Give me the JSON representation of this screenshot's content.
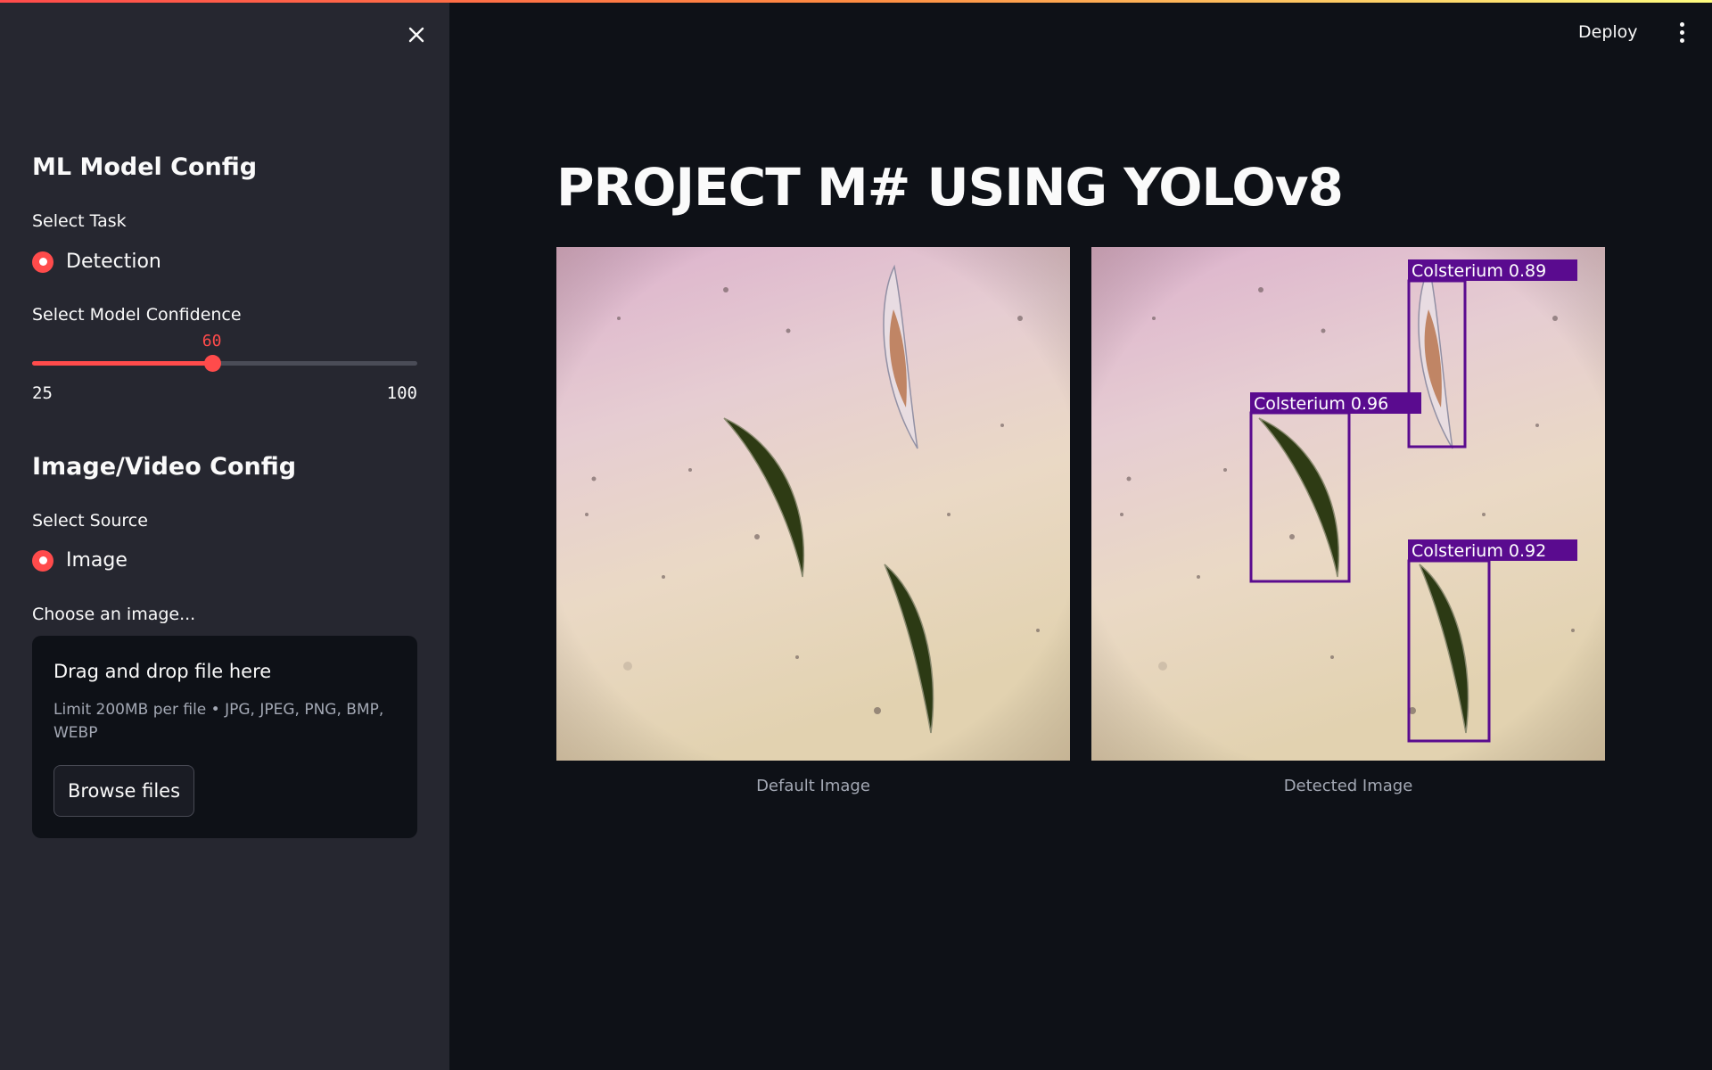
{
  "header": {
    "deploy_label": "Deploy",
    "menu_icon": "kebab-menu-icon"
  },
  "sidebar": {
    "close_icon": "close-icon",
    "model_config_heading": "ML Model Config",
    "task_label": "Select Task",
    "task_selected": "Detection",
    "confidence_label": "Select Model Confidence",
    "confidence": {
      "value": "60",
      "min": "25",
      "max": "100"
    },
    "source_heading": "Image/Video Config",
    "source_label": "Select Source",
    "source_selected": "Image",
    "choose_label": "Choose an image...",
    "uploader": {
      "title": "Drag and drop file here",
      "limit": "Limit 200MB per file • JPG, JPEG, PNG, BMP, WEBP",
      "button": "Browse files"
    }
  },
  "main": {
    "title": "PROJECT M# USING YOLOv8",
    "images": [
      {
        "caption": "Default Image"
      },
      {
        "caption": "Detected Image",
        "detections": [
          {
            "label": "Colsterium 0.89"
          },
          {
            "label": "Colsterium 0.96"
          },
          {
            "label": "Colsterium 0.92"
          }
        ]
      }
    ]
  },
  "colors": {
    "accent": "#ff4b4b",
    "sidebar_bg": "#262730",
    "main_bg": "#0e1117",
    "box_color": "#5a0b8f"
  }
}
